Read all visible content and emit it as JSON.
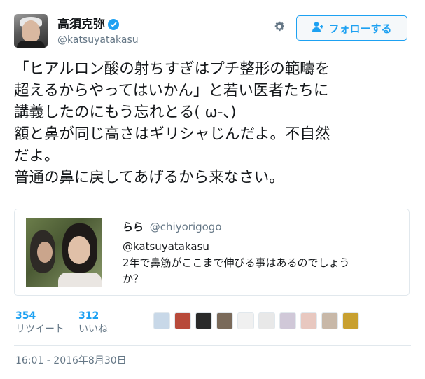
{
  "user": {
    "display_name": "高須克弥",
    "handle": "@katsuyatakasu",
    "verified": true
  },
  "follow_button": {
    "label": "フォローする"
  },
  "tweet": {
    "lines": [
      "「ヒアルロン酸の射ちすぎはプチ整形の範疇を",
      "超えるからやってはいかん」と若い医者たちに",
      "講義したのにもう忘れとる( ω-、)",
      "額と鼻が同じ高さはギリシャじんだよ。不自然",
      "だよ。",
      "普通の鼻に戻してあげるから来なさい。"
    ]
  },
  "quote": {
    "name": "らら",
    "handle": "@chiyorigogo",
    "lines": [
      "@katsuyatakasu",
      "2年で鼻筋がここまで伸びる事はあるのでしょう",
      "か？"
    ]
  },
  "stats": {
    "retweets": {
      "count": "354",
      "label": "リツイート"
    },
    "likes": {
      "count": "312",
      "label": "いいね"
    }
  },
  "liker_avatars": [
    "#c8d8e8",
    "#b84a3a",
    "#2a2a2a",
    "#7a6a5a",
    "#f0f0f0",
    "#e8e8e8",
    "#d0c8d8",
    "#e8c8c0",
    "#c8b8a8",
    "#c8a030"
  ],
  "timestamp": "16:01 - 2016年8月30日",
  "colors": {
    "accent": "#1da1f2",
    "secondary_text": "#657786",
    "border": "#e1e8ed"
  },
  "icons": [
    "verified-badge-icon",
    "gear-icon",
    "follow-user-icon"
  ]
}
